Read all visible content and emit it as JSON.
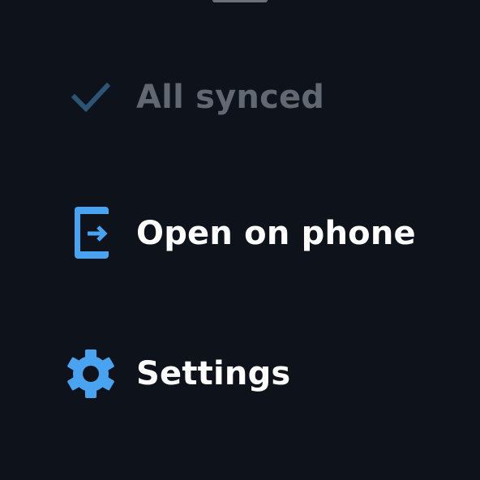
{
  "colors": {
    "background": "#0d121b",
    "accent": "#4aa3f0",
    "disabled_icon": "#2c5573",
    "disabled_text": "#616872",
    "text": "#ffffff"
  },
  "menu": {
    "items": [
      {
        "label": "All synced",
        "icon": "check-icon",
        "enabled": false
      },
      {
        "label": "Open on phone",
        "icon": "open-on-phone-icon",
        "enabled": true
      },
      {
        "label": "Settings",
        "icon": "gear-icon",
        "enabled": true
      }
    ]
  }
}
